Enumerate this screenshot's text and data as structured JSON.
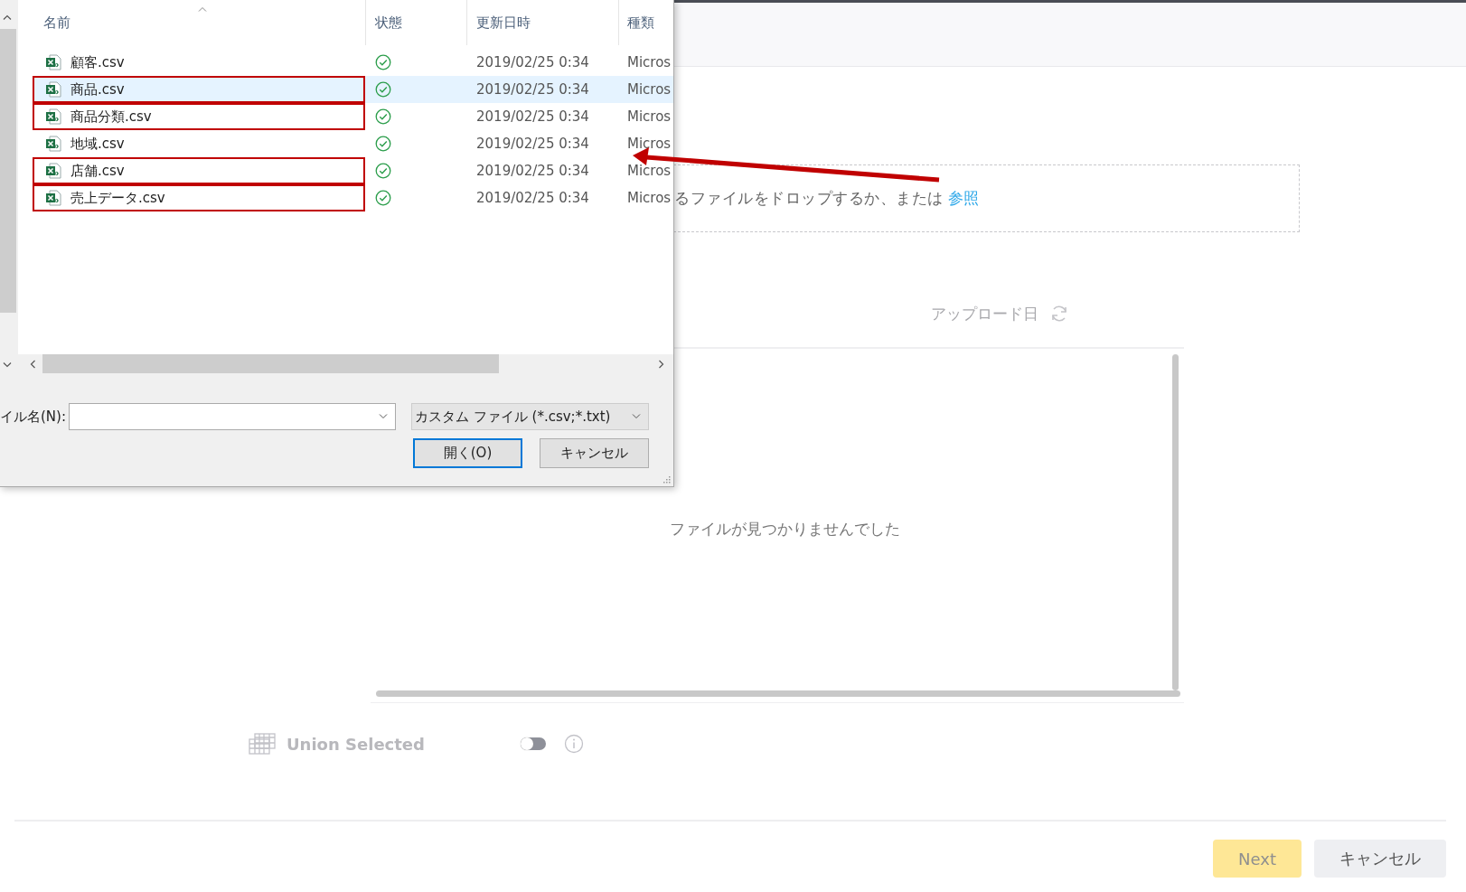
{
  "dialog": {
    "columns": [
      "名前",
      "状態",
      "更新日時",
      "種類"
    ],
    "files": [
      {
        "name": "顧客.csv",
        "date": "2019/02/25 0:34",
        "type": "Micros",
        "selected": false,
        "marked": false
      },
      {
        "name": "商品.csv",
        "date": "2019/02/25 0:34",
        "type": "Micros",
        "selected": true,
        "marked": true
      },
      {
        "name": "商品分類.csv",
        "date": "2019/02/25 0:34",
        "type": "Micros",
        "selected": false,
        "marked": true
      },
      {
        "name": "地域.csv",
        "date": "2019/02/25 0:34",
        "type": "Micros",
        "selected": false,
        "marked": false
      },
      {
        "name": "店舗.csv",
        "date": "2019/02/25 0:34",
        "type": "Micros",
        "selected": false,
        "marked": true
      },
      {
        "name": "売上データ.csv",
        "date": "2019/02/25 0:34",
        "type": "Micros",
        "selected": false,
        "marked": true
      }
    ],
    "filename_label": "イル名(N):",
    "filter": "カスタム ファイル (*.csv;*.txt)",
    "open_button": "開く(O)",
    "cancel_button": "キャンセル"
  },
  "page": {
    "drop_text": "るファイルをドロップするか、または",
    "browse_link": "参照",
    "upload_date_label": "アップロード日",
    "empty_message": "ファイルが見つかりませんでした",
    "union_label": "Union Selected",
    "union_toggle_on": false,
    "next_button": "Next",
    "next_disabled": true,
    "cancel_button": "キャンセル"
  }
}
